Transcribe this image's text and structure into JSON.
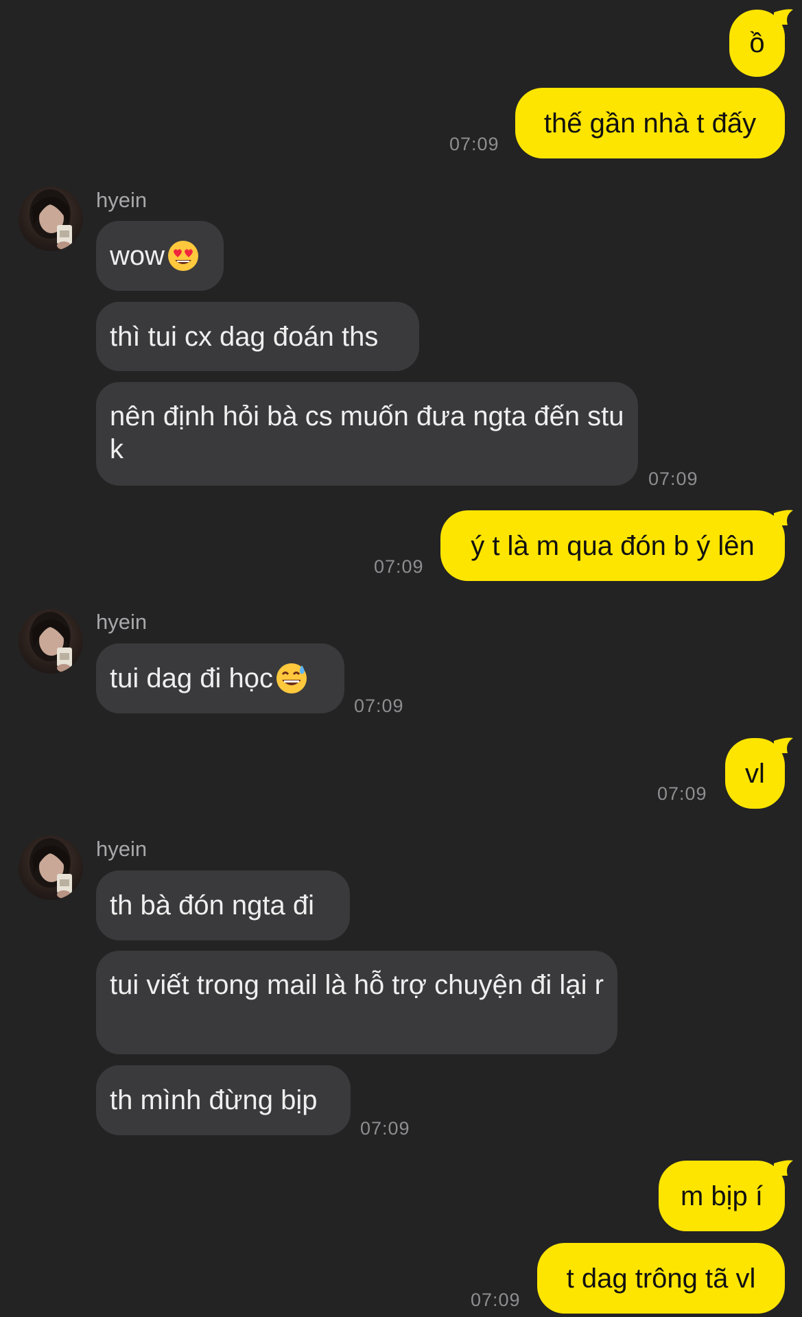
{
  "contact": {
    "name": "hyein"
  },
  "messages": {
    "m1": {
      "text": "ồ"
    },
    "m2": {
      "text": "thế gần nhà t đấy",
      "time": "07:09"
    },
    "m3": {
      "text": "wow"
    },
    "m4": {
      "text": "thì tui cx dag đoán ths"
    },
    "m5": {
      "text": "nên định hỏi bà cs muốn đưa ngta đến stu k",
      "time": "07:09"
    },
    "m6": {
      "text": "ý t là m qua đón b ý lên",
      "time": "07:09"
    },
    "m7": {
      "text": "tui dag đi học",
      "time": "07:09"
    },
    "m8": {
      "text": "vl",
      "time": "07:09"
    },
    "m9": {
      "text": "th bà đón ngta đi"
    },
    "m10": {
      "text": "tui viết trong mail là hỗ trợ chuyện đi lại r"
    },
    "m11": {
      "text": "th mình đừng bịp",
      "time": "07:09"
    },
    "m12": {
      "text": "m bịp í"
    },
    "m13": {
      "text": "t dag trông tã vl",
      "time": "07:09"
    }
  },
  "colors": {
    "background": "#232324",
    "my_bubble": "#FEE500",
    "their_bubble": "#3A3A3C",
    "timestamp": "#8E8E90"
  },
  "icons": {
    "emoji_1": "heart-eyes-emoji-icon",
    "emoji_2": "grinning-sweat-emoji-icon",
    "avatar": "contact-avatar"
  }
}
